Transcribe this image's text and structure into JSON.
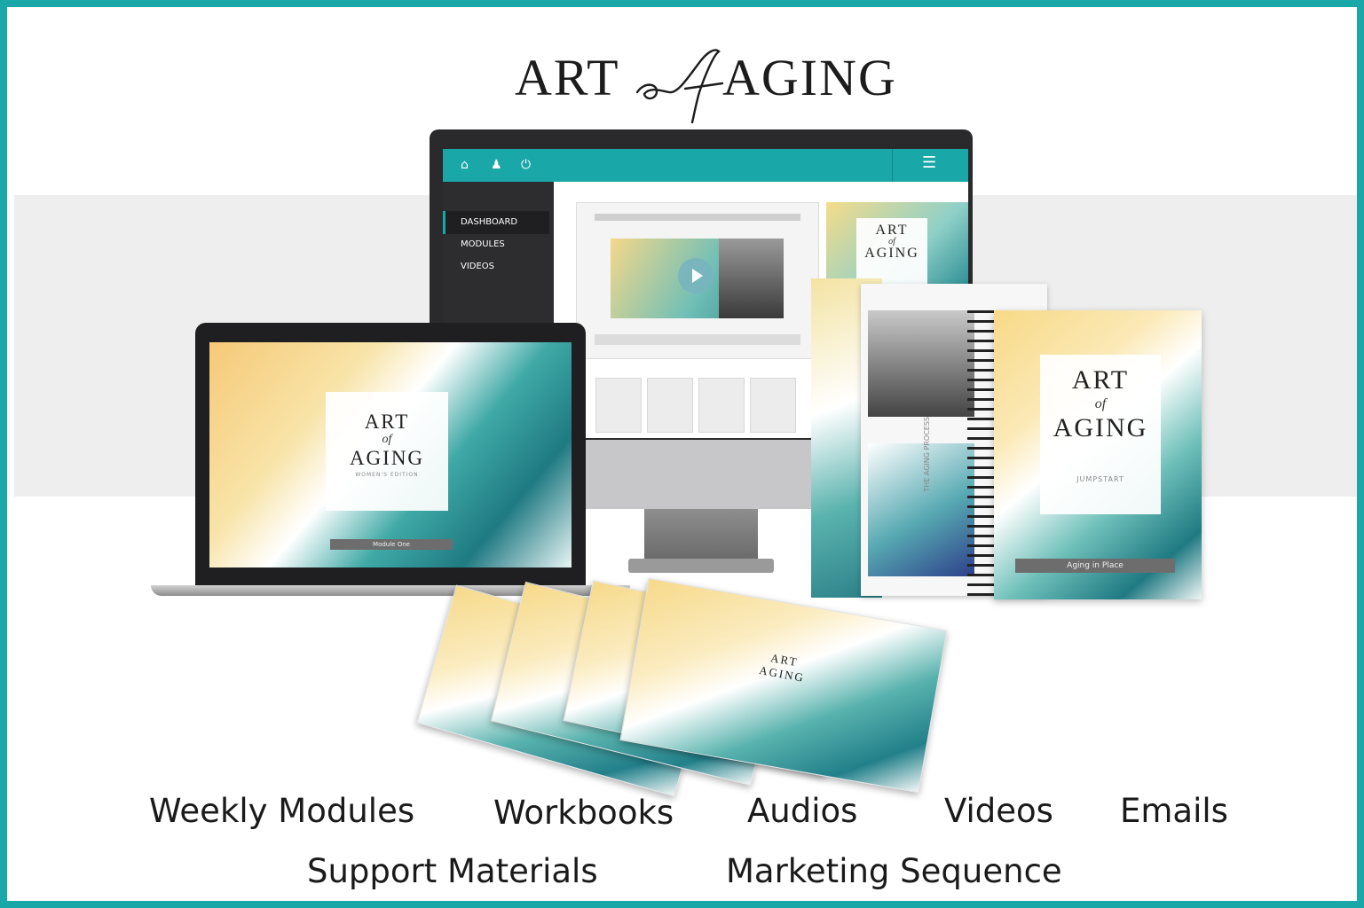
{
  "brand": {
    "logo_left": "ART",
    "logo_middle": "of",
    "logo_right": "AGING",
    "accent_color": "#1aa7a8"
  },
  "monitor": {
    "topbar_icons": [
      "home-icon",
      "user-icon",
      "power-icon",
      "menu-icon"
    ],
    "sidebar_items": [
      "DASHBOARD",
      "MODULES",
      "VIDEOS"
    ],
    "poster": {
      "line1": "ART",
      "line2": "of",
      "line3": "AGING"
    }
  },
  "laptop": {
    "cover_line1": "ART",
    "cover_line2": "of",
    "cover_line3": "AGING",
    "cover_subtitle": "WOMEN'S EDITION",
    "label": "Module One"
  },
  "notebook": {
    "spine_text": "THE AGING PROCESS"
  },
  "jumpstart": {
    "cover_line1": "ART",
    "cover_line2": "of",
    "cover_line3": "AGING",
    "subtitle": "JUMPSTART",
    "label": "Aging in Place"
  },
  "booklet": {
    "line1": "ART",
    "line2": "AGING"
  },
  "captions": {
    "row1": [
      "Weekly Modules",
      "Workbooks",
      "Audios",
      "Videos",
      "Emails"
    ],
    "row2": [
      "Support Materials",
      "Marketing Sequence"
    ]
  }
}
